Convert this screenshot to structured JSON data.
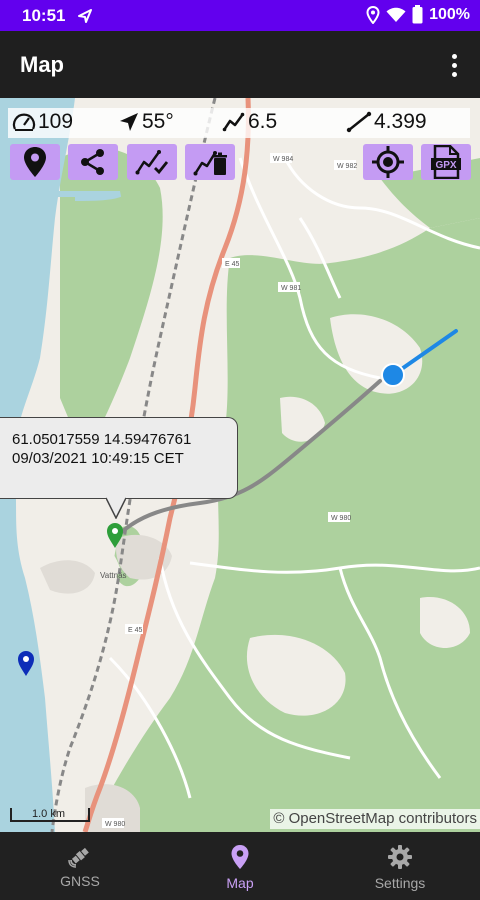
{
  "status_bar": {
    "time": "10:51",
    "battery": "100%"
  },
  "app_bar": {
    "title": "Map"
  },
  "stats": {
    "speed": "109",
    "bearing": "55°",
    "slope": "6.5",
    "distance": "4.399"
  },
  "toolbar": {
    "left_icons": [
      "location-pin-icon",
      "share-icon",
      "track-check-icon",
      "track-delete-icon"
    ],
    "right_icons": [
      "gps-target-icon",
      "gpx-file-icon"
    ]
  },
  "callout": {
    "coordinates": "61.05017559 14.59476761",
    "datetime": "09/03/2021 10:49:15 CET"
  },
  "map": {
    "scale_label": "1.0 km",
    "attribution": "© OpenStreetMap contributors",
    "town_label": "Vattnäs",
    "road_labels": [
      "W 984",
      "W 982",
      "E 45",
      "W 981",
      "W 980",
      "E 45",
      "W 980"
    ]
  },
  "bottom_nav": {
    "items": [
      {
        "label": "GNSS",
        "icon": "satellite-icon",
        "active": false
      },
      {
        "label": "Map",
        "icon": "map-pin-icon",
        "active": true
      },
      {
        "label": "Settings",
        "icon": "gear-icon",
        "active": false
      }
    ]
  },
  "colors": {
    "status_bar": "#6200ee",
    "accent": "#c49bf3",
    "track": "#888888",
    "live_track": "#1e88e5",
    "start_marker": "#2e9e3a",
    "waypoint_marker": "#0d2db8"
  }
}
